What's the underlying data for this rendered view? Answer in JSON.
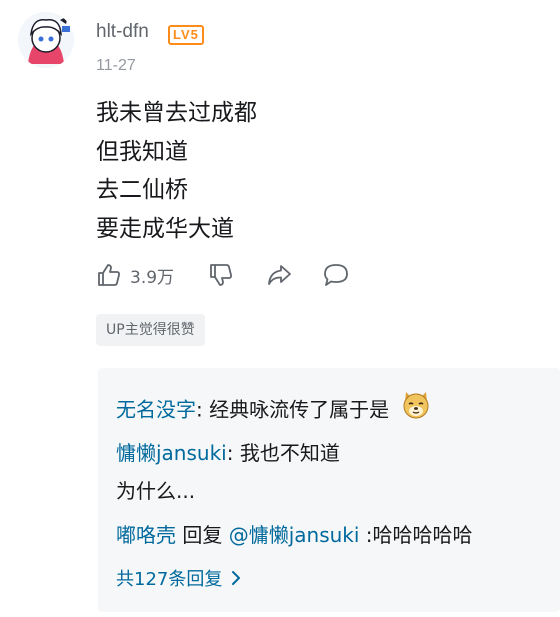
{
  "comment": {
    "username": "hlt-dfn",
    "level": "LV5",
    "date": "11-27",
    "lines": [
      "我未曾去过成都",
      "但我知道",
      "去二仙桥",
      "要走成华大道"
    ],
    "like_count": "3.9万",
    "up_liked_label": "UP主觉得很赞"
  },
  "replies": {
    "items": [
      {
        "user": "无名没字",
        "sep": ": ",
        "text": "经典咏流传了属于是",
        "emoji": "doge-emoji"
      },
      {
        "user": "慵懒jansuki",
        "sep": ": ",
        "text": "我也不知道",
        "text2": "为什么..."
      },
      {
        "user": "嘟咯壳",
        "mid": " 回复 ",
        "mention": "@慵懒jansuki",
        "text": " :哈哈哈哈哈"
      }
    ],
    "more_label": "共127条回复"
  },
  "icons": [
    "avatar-image",
    "thumbs-up-icon",
    "thumbs-down-icon",
    "share-icon",
    "comment-icon",
    "chevron-right-icon"
  ],
  "colors": {
    "link": "#00699d",
    "level_badge": "#ff8c1a",
    "muted": "#9499a0",
    "reply_bg": "#f6f7f8"
  }
}
